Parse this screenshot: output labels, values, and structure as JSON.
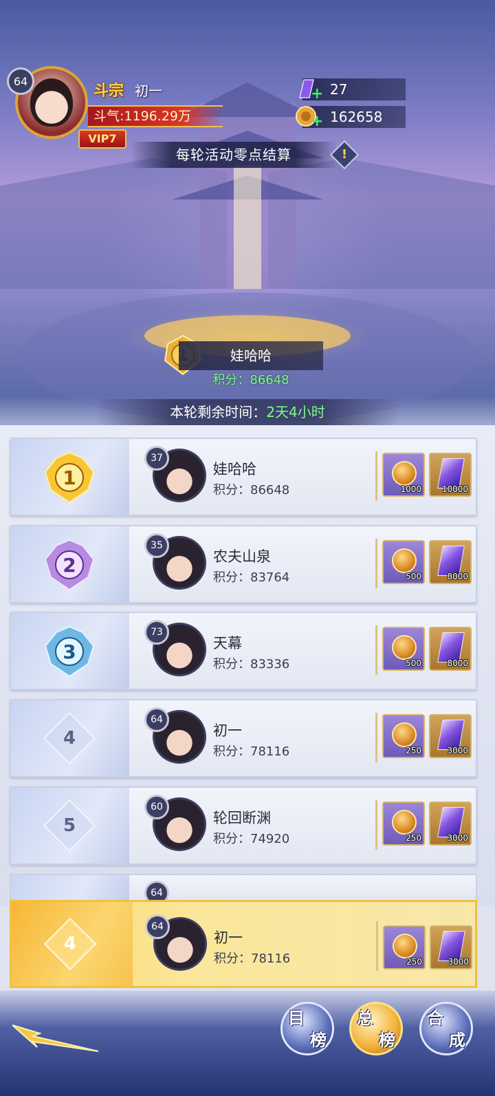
{
  "player": {
    "level": "64",
    "title": "斗宗",
    "name": "初一",
    "power": "斗气:1196.29万",
    "vip": "VIP7"
  },
  "resources": [
    {
      "icon": "purple-crystal-icon",
      "value": "27"
    },
    {
      "icon": "gold-coin-icon",
      "value": "162658"
    }
  ],
  "settlement_notice": "每轮活动零点结算",
  "info_label": "!",
  "top_player": {
    "rank": "1",
    "name": "娃哈哈",
    "score": "积分：86648"
  },
  "timer": {
    "label": "本轮剩余时间：",
    "value": "2天4小时"
  },
  "rows": [
    {
      "rank": "1",
      "level": "37",
      "name": "娃哈哈",
      "score": "积分：86648",
      "reward_coin": "1000",
      "reward_gem": "10000"
    },
    {
      "rank": "2",
      "level": "35",
      "name": "农夫山泉",
      "score": "积分：83764",
      "reward_coin": "500",
      "reward_gem": "8000"
    },
    {
      "rank": "3",
      "level": "73",
      "name": "天幕",
      "score": "积分：83336",
      "reward_coin": "500",
      "reward_gem": "8000"
    },
    {
      "rank": "4",
      "level": "64",
      "name": "初一",
      "score": "积分：78116",
      "reward_coin": "250",
      "reward_gem": "3000"
    },
    {
      "rank": "5",
      "level": "60",
      "name": "轮回断渊",
      "score": "积分：74920",
      "reward_coin": "250",
      "reward_gem": "3000"
    }
  ],
  "partial_row": {
    "level": "64"
  },
  "my_rank": {
    "rank": "4",
    "level": "64",
    "name": "初一",
    "score": "积分：78116",
    "reward_coin": "250",
    "reward_gem": "3000"
  },
  "nav": [
    {
      "l1": "目",
      "l2": "榜",
      "active": false
    },
    {
      "l1": "总",
      "l2": "榜",
      "active": true
    },
    {
      "l1": "合",
      "l2": "成",
      "active": false
    }
  ],
  "colors": {
    "accent_gold": "#ffd34a",
    "score_green": "#7dff8c",
    "vip_red": "#c9242c"
  }
}
